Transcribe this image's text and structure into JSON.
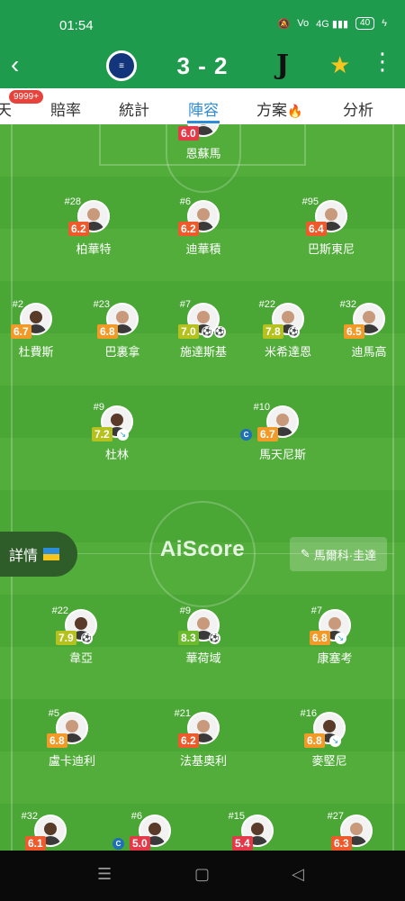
{
  "status": {
    "time": "01:54",
    "icons": [
      "mute-icon",
      "volte-icon",
      "4g-signal-icon"
    ],
    "battery": "40"
  },
  "header": {
    "back_icon": "chevron-left-icon",
    "home_team_logo": "inter-logo",
    "score": "3 - 2",
    "away_team_logo": "juventus-logo",
    "favorite_icon": "star-icon",
    "more_icon": "more-vertical-icon"
  },
  "tabs": [
    {
      "label": "天",
      "badge": "9999+"
    },
    {
      "label": "賠率"
    },
    {
      "label": "統計"
    },
    {
      "label": "陣容",
      "active": true
    },
    {
      "label": "方案",
      "icon": "fire-icon"
    },
    {
      "label": "分析"
    }
  ],
  "pitch": {
    "watermark": "AiScore",
    "detail_button": "詳情",
    "coach": "馬爾科·圭達",
    "away": {
      "gk": [
        {
          "num": "",
          "rating": "6.0",
          "name": "恩蘇馬"
        }
      ],
      "def": [
        {
          "num": "#28",
          "rating": "6.2",
          "name": "柏華特"
        },
        {
          "num": "#6",
          "rating": "6.2",
          "name": "迪華積"
        },
        {
          "num": "#95",
          "rating": "6.4",
          "name": "巴斯東尼"
        }
      ],
      "mid": [
        {
          "num": "#2",
          "rating": "6.7",
          "name": "杜費斯"
        },
        {
          "num": "#23",
          "rating": "6.8",
          "name": "巴裏拿"
        },
        {
          "num": "#7",
          "rating": "7.0",
          "name": "施達斯基"
        },
        {
          "num": "#22",
          "rating": "7.8",
          "name": "米希達恩"
        },
        {
          "num": "#32",
          "rating": "6.5",
          "name": "迪馬高"
        }
      ],
      "fwd": [
        {
          "num": "#9",
          "rating": "7.2",
          "name": "杜林"
        },
        {
          "num": "#10",
          "rating": "6.7",
          "name": "馬天尼斯",
          "captain": "C"
        }
      ]
    },
    "home": {
      "fwd": [
        {
          "num": "#22",
          "rating": "7.9",
          "name": "韋亞"
        },
        {
          "num": "#9",
          "rating": "8.3",
          "name": "華荷域"
        },
        {
          "num": "#7",
          "rating": "6.8",
          "name": "康塞考"
        }
      ],
      "mid": [
        {
          "num": "#5",
          "rating": "6.8",
          "name": "盧卡迪利"
        },
        {
          "num": "#21",
          "rating": "6.2",
          "name": "法基奧利"
        },
        {
          "num": "#16",
          "rating": "6.8",
          "name": "麥堅尼"
        }
      ],
      "def": [
        {
          "num": "#32",
          "rating": "6.1",
          "name": ""
        },
        {
          "num": "#6",
          "rating": "5.0",
          "name": "",
          "captain": "C"
        },
        {
          "num": "#15",
          "rating": "5.4",
          "name": ""
        },
        {
          "num": "#27",
          "rating": "6.3",
          "name": ""
        }
      ]
    }
  },
  "navbar": {
    "menu_icon": "menu-icon",
    "home_icon": "square-icon",
    "back_icon": "triangle-back-icon"
  },
  "colors": {
    "header": "#1f9b4e",
    "accent": "#2e8dd8",
    "pitch": "#52ad3b",
    "star": "#f7c51e"
  }
}
